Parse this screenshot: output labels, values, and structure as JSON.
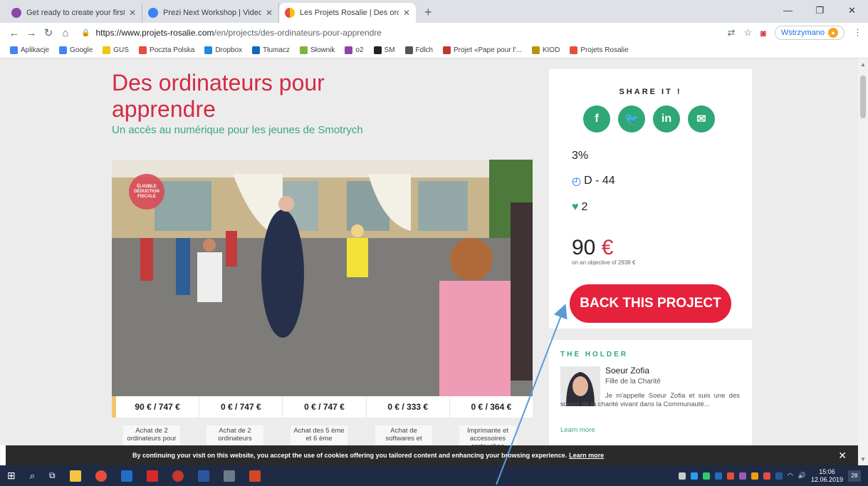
{
  "browser": {
    "tabs": [
      {
        "title": "Get ready to create your first pre",
        "active": false,
        "color": "#8e44ad"
      },
      {
        "title": "Prezi Next Workshop | Videos, Le",
        "active": false,
        "color": "#3b82f6"
      },
      {
        "title": "Les Projets Rosalie | Des ordinate",
        "active": true,
        "color": "#e74c3c"
      }
    ],
    "new_tab": "+",
    "url_host": "https://www.projets-rosalie.com",
    "url_path": "/en/projects/des-ordinateurs-pour-apprendre",
    "paused_label": "Wstrzymano",
    "bookmarks": [
      {
        "label": "Aplikacje",
        "color": "#4285f4"
      },
      {
        "label": "Google",
        "color": "#4285f4"
      },
      {
        "label": "GUS",
        "color": "#f1c40f"
      },
      {
        "label": "Poczta Polska",
        "color": "#e74c3c"
      },
      {
        "label": "Dropbox",
        "color": "#1e88e5"
      },
      {
        "label": "Tłumacz",
        "color": "#1565c0"
      },
      {
        "label": "Słownik",
        "color": "#7cb342"
      },
      {
        "label": "o2",
        "color": "#8e44ad"
      },
      {
        "label": "SM",
        "color": "#222222"
      },
      {
        "label": "Fdlch",
        "color": "#555555"
      },
      {
        "label": "Projet «Pape pour l'...",
        "color": "#c0392b"
      },
      {
        "label": "KIOD",
        "color": "#b7950b"
      },
      {
        "label": "Projets Rosalie",
        "color": "#e74c3c"
      }
    ]
  },
  "project": {
    "title": "Des ordinateurs pour apprendre",
    "subtitle": "Un accès au numérique pour les jeunes de Smotrych",
    "badge": "ÉLIGIBLE DÉDUCTION FISCALE",
    "goals": [
      {
        "amount": "90 € / 747 €",
        "desc": "Achat de 2 ordinateurs pour"
      },
      {
        "amount": "0 € / 747 €",
        "desc": "Achat de 2 ordinateurs"
      },
      {
        "amount": "0 € / 747 €",
        "desc": "Achat des 5 ème et 6 ème"
      },
      {
        "amount": "0 € / 333 €",
        "desc": "Achat de softwares et"
      },
      {
        "amount": "0 € / 364 €",
        "desc": "Imprimante et accessoires cartouches"
      }
    ]
  },
  "share": {
    "heading": "SHARE IT !",
    "percent": "3%",
    "days": "D - 44",
    "likes": "2",
    "amount": "90",
    "currency": "€",
    "objective": "on an objective of 2938 €",
    "back_button": "BACK THIS PROJECT",
    "brand_green": "#2fa776",
    "brand_red": "#e5213b"
  },
  "holder": {
    "heading": "THE HOLDER",
    "name": "Soeur Zofia",
    "role": "Fille de la Charité",
    "bio": "Je m'appelle Soeur Zofia et suis une des sœurs de la charité vivant dans la Communauté...",
    "learn_more": "Learn more"
  },
  "cookie": {
    "text": "By continuing your visit on this website, you accept the use of cookies offering you tailored content and enhancing your browsing experience.",
    "link": "Learn more",
    "close": "✕"
  },
  "taskbar": {
    "time": "15:06",
    "date": "12.06.2019",
    "notifications": "28"
  }
}
